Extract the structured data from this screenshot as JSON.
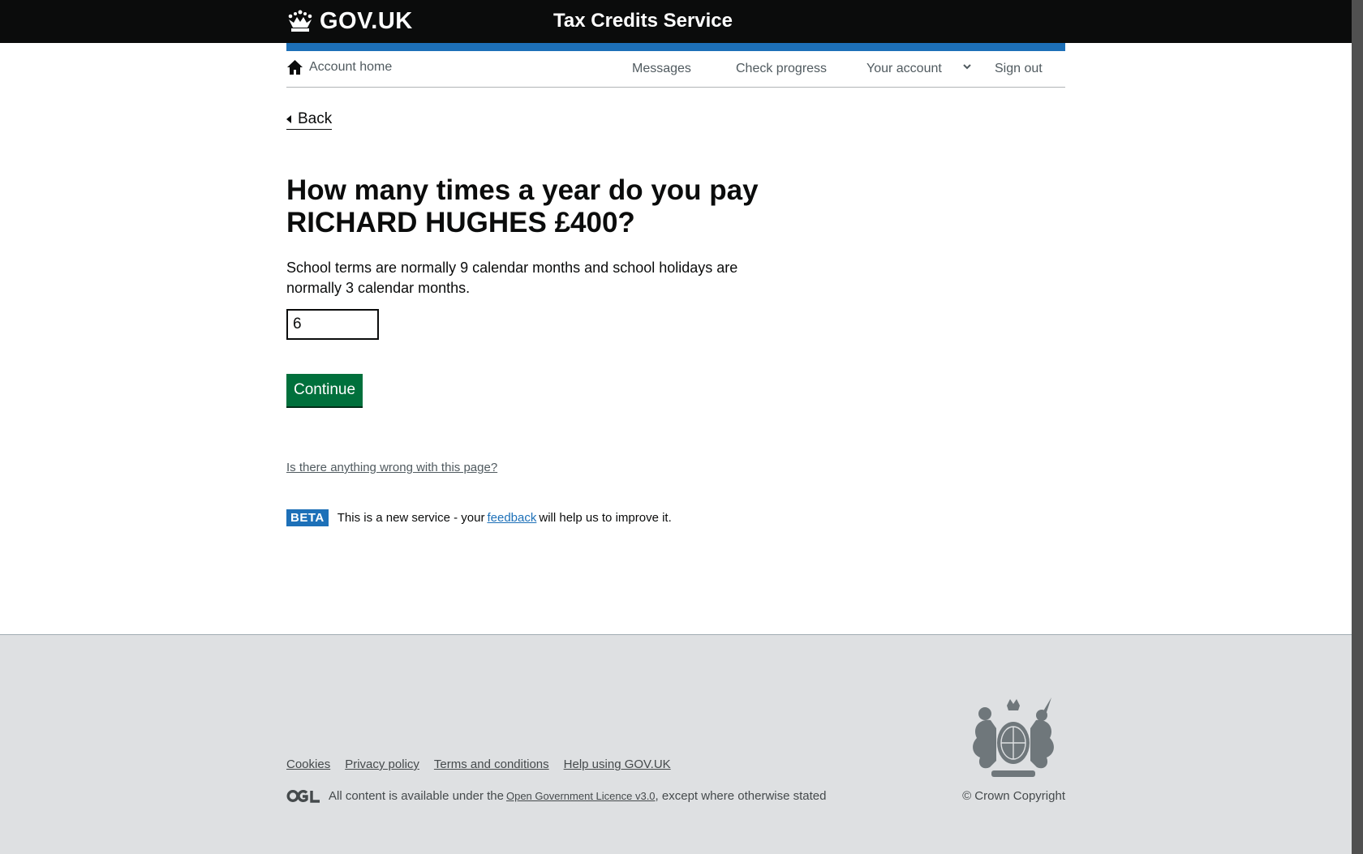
{
  "header": {
    "logo_text": "GOV.UK",
    "service_name": "Tax Credits Service"
  },
  "account_nav": {
    "home_label": "Account home",
    "messages_label": "Messages",
    "check_progress_label": "Check progress",
    "your_account_label": "Your account",
    "sign_out_label": "Sign out"
  },
  "back_label": "Back",
  "main": {
    "heading_line1": "How many times a year do you pay",
    "heading_line2": "RICHARD HUGHES £400?",
    "hint_line1": "School terms are normally 9 calendar months and school holidays are",
    "hint_line2": "normally 3 calendar months.",
    "input_value": "6",
    "continue_label": "Continue",
    "report_link": "Is there anything wrong with this page?"
  },
  "beta": {
    "tag": "BETA",
    "text_before": "This is a new service  - your",
    "feedback_link": "feedback",
    "text_after": "will help us to improve it."
  },
  "footer": {
    "links": [
      "Cookies",
      "Privacy policy",
      "Terms and conditions",
      "Help using GOV.UK"
    ],
    "licence_before": "All content is available under the",
    "licence_link": "Open Government Licence v3.0",
    "licence_after": ", except where otherwise stated",
    "copyright": "© Crown Copyright"
  },
  "colors": {
    "header_bg": "#0b0c0c",
    "brand_blue": "#1d70b8",
    "button_green": "#00703c",
    "footer_bg": "#dee0e2"
  },
  "icons": [
    "crown-icon",
    "home-icon",
    "chevron-down-icon",
    "back-arrow-icon",
    "ogl-logo-icon",
    "royal-crest-icon"
  ]
}
